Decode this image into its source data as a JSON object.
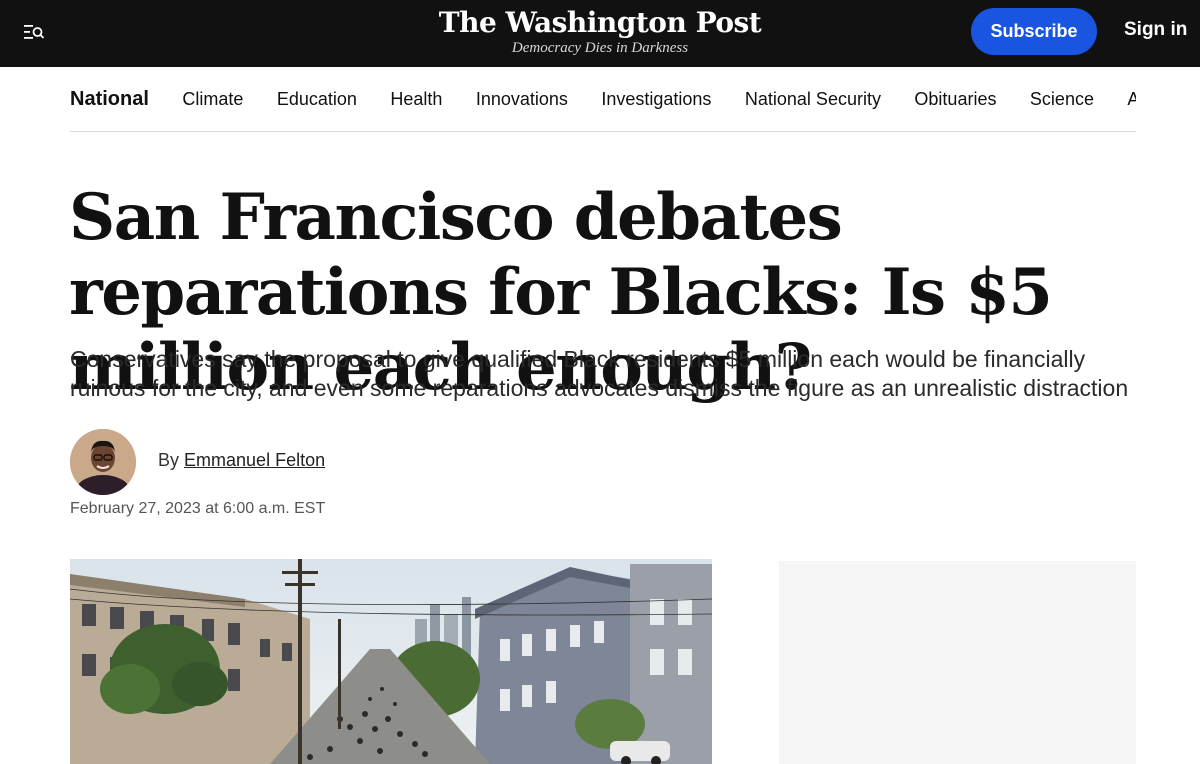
{
  "header": {
    "menu_icon": "menu-search-icon",
    "logo": "The Washington Post",
    "tagline": "Democracy Dies in Darkness",
    "subscribe_label": "Subscribe",
    "signin_label": "Sign in",
    "colors": {
      "bar": "#111111",
      "subscribe": "#1955e0"
    }
  },
  "section_nav": {
    "items": [
      {
        "label": "National",
        "active": true
      },
      {
        "label": "Climate"
      },
      {
        "label": "Education"
      },
      {
        "label": "Health"
      },
      {
        "label": "Innovations"
      },
      {
        "label": "Investigations"
      },
      {
        "label": "National Security"
      },
      {
        "label": "Obituaries"
      },
      {
        "label": "Science"
      },
      {
        "label": "Abortion"
      }
    ]
  },
  "article": {
    "headline": "San Francisco debates reparations for Blacks: Is $5 million each enough?",
    "dek": "Conservatives say the proposal to give qualified Black residents $5 million each would be financially ruinous for the city, and even some reparations advocates dismiss the figure as an unrealistic distraction",
    "byline_prefix": "By",
    "author": "Emmanuel Felton",
    "date": "February 27, 2023 at 6:00 a.m. EST"
  }
}
